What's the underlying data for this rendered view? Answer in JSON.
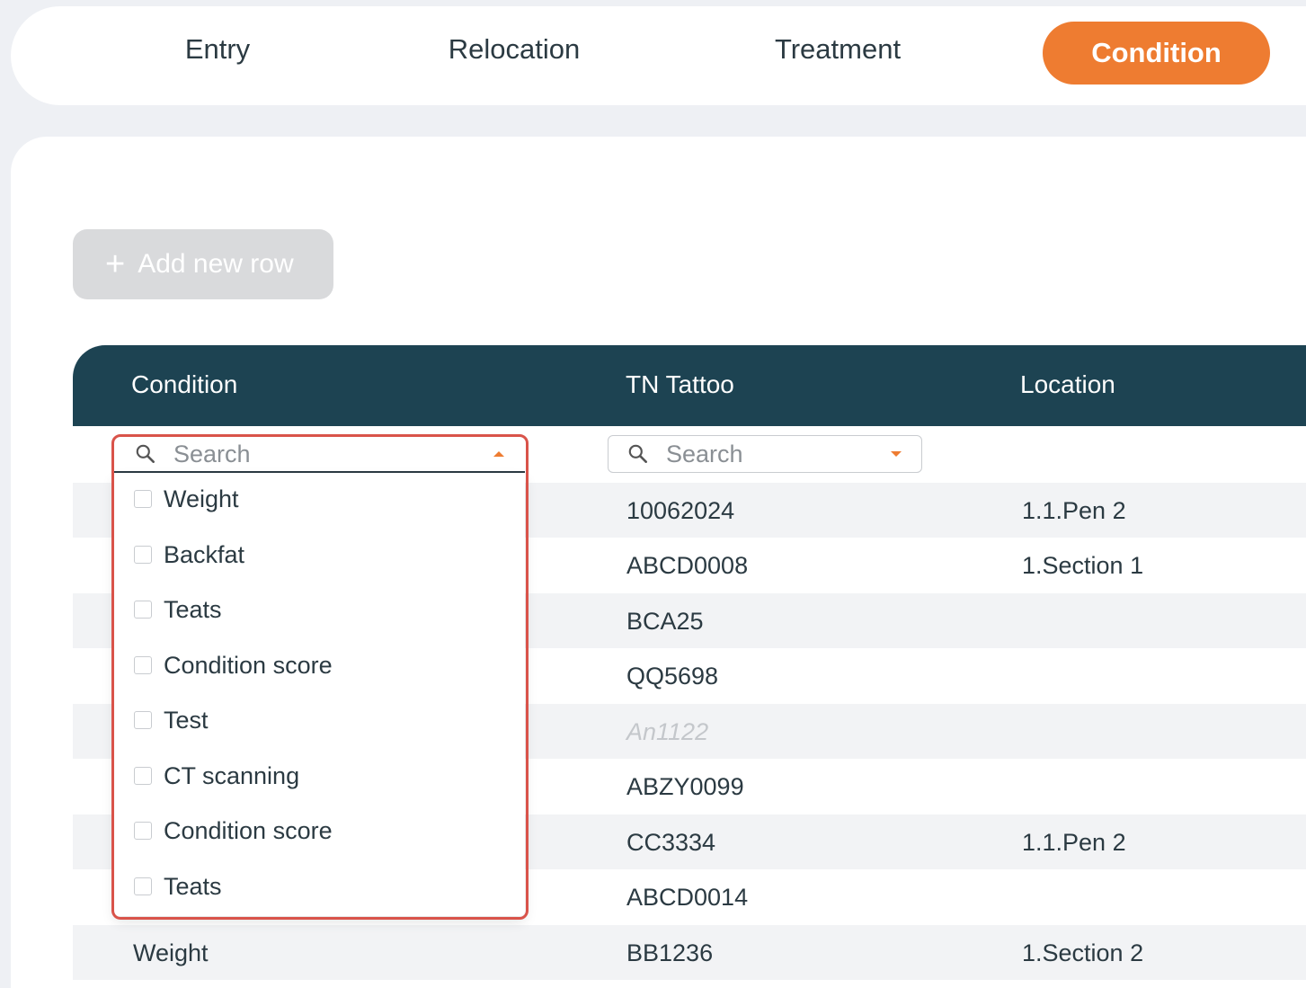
{
  "tabs": [
    {
      "label": "Entry"
    },
    {
      "label": "Relocation"
    },
    {
      "label": "Treatment"
    },
    {
      "label": "Condition",
      "active": true
    }
  ],
  "toolbar": {
    "add_row_label": "Add new row"
  },
  "table": {
    "columns": [
      "Condition",
      "TN Tattoo",
      "Location"
    ],
    "condition_filter_placeholder": "Search",
    "tattoo_filter_placeholder": "Search",
    "rows": [
      {
        "condition": "",
        "tattoo": "10062024",
        "location": "1.1.Pen 2"
      },
      {
        "condition": "",
        "tattoo": "ABCD0008",
        "location": "1.Section 1"
      },
      {
        "condition": "",
        "tattoo": "BCA25",
        "location": ""
      },
      {
        "condition": "",
        "tattoo": "QQ5698",
        "location": ""
      },
      {
        "condition": "",
        "tattoo": "An1122",
        "location": ""
      },
      {
        "condition": "",
        "tattoo": "ABZY0099",
        "location": ""
      },
      {
        "condition": "",
        "tattoo": "CC3334",
        "location": "1.1.Pen 2"
      },
      {
        "condition": "",
        "tattoo": "ABCD0014",
        "location": ""
      },
      {
        "condition": "Weight",
        "tattoo": "BB1236",
        "location": "1.Section 2"
      }
    ]
  },
  "condition_dropdown": {
    "options": [
      "Weight",
      "Backfat",
      "Teats",
      "Condition score",
      "Test",
      "CT scanning",
      "Condition score",
      "Teats"
    ]
  },
  "colors": {
    "accent": "#ee7c31",
    "header": "#1d4352",
    "highlight": "#d9534a"
  }
}
